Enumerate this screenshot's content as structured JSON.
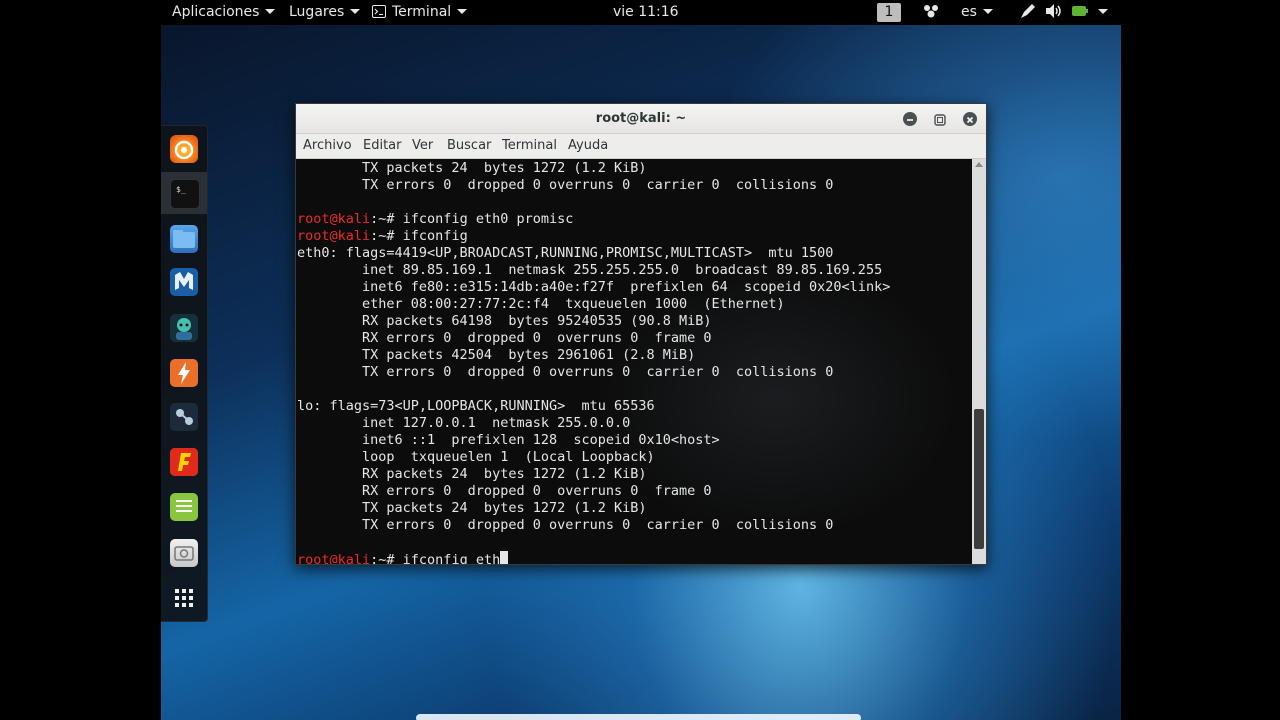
{
  "topbar": {
    "apps": "Aplicaciones",
    "places": "Lugares",
    "terminal": "Terminal",
    "clock": "vie 11:16",
    "workspace": "1",
    "lang": "es"
  },
  "dock": {
    "icons": [
      "firefox-icon",
      "terminal-icon",
      "files-icon",
      "metasploit-icon",
      "armitage-icon",
      "burpsuite-icon",
      "maltego-icon",
      "faraday-icon",
      "leafpad-icon",
      "screenshot-icon",
      "show-apps-icon"
    ]
  },
  "window": {
    "title": "root@kali: ~",
    "menu": [
      "Archivo",
      "Editar",
      "Ver",
      "Buscar",
      "Terminal",
      "Ayuda"
    ]
  },
  "terminal": {
    "prompt": "root@kali",
    "prompt_path": ":~# ",
    "lines": [
      {
        "text": "        TX packets 24  bytes 1272 (1.2 KiB)"
      },
      {
        "text": "        TX errors 0  dropped 0 overruns 0  carrier 0  collisions 0"
      },
      {
        "text": ""
      },
      {
        "prompt": true,
        "cmd": "ifconfig eth0 promisc"
      },
      {
        "prompt": true,
        "cmd": "ifconfig"
      },
      {
        "text": "eth0: flags=4419<UP,BROADCAST,RUNNING,PROMISC,MULTICAST>  mtu 1500"
      },
      {
        "text": "        inet 89.85.169.1  netmask 255.255.255.0  broadcast 89.85.169.255"
      },
      {
        "text": "        inet6 fe80::e315:14db:a40e:f27f  prefixlen 64  scopeid 0x20<link>"
      },
      {
        "text": "        ether 08:00:27:77:2c:f4  txqueuelen 1000  (Ethernet)"
      },
      {
        "text": "        RX packets 64198  bytes 95240535 (90.8 MiB)"
      },
      {
        "text": "        RX errors 0  dropped 0  overruns 0  frame 0"
      },
      {
        "text": "        TX packets 42504  bytes 2961061 (2.8 MiB)"
      },
      {
        "text": "        TX errors 0  dropped 0 overruns 0  carrier 0  collisions 0"
      },
      {
        "text": ""
      },
      {
        "text": "lo: flags=73<UP,LOOPBACK,RUNNING>  mtu 65536"
      },
      {
        "text": "        inet 127.0.0.1  netmask 255.0.0.0"
      },
      {
        "text": "        inet6 ::1  prefixlen 128  scopeid 0x10<host>"
      },
      {
        "text": "        loop  txqueuelen 1  (Local Loopback)"
      },
      {
        "text": "        RX packets 24  bytes 1272 (1.2 KiB)"
      },
      {
        "text": "        RX errors 0  dropped 0  overruns 0  frame 0"
      },
      {
        "text": "        TX packets 24  bytes 1272 (1.2 KiB)"
      },
      {
        "text": "        TX errors 0  dropped 0 overruns 0  carrier 0  collisions 0"
      },
      {
        "text": ""
      },
      {
        "prompt": true,
        "cmd": "ifconfig eth",
        "cursor": true
      }
    ]
  },
  "colors": {
    "prompt": "#ef2929",
    "terminal_text": "#e6e6e6",
    "terminal_bg": "#0c0c0c"
  }
}
